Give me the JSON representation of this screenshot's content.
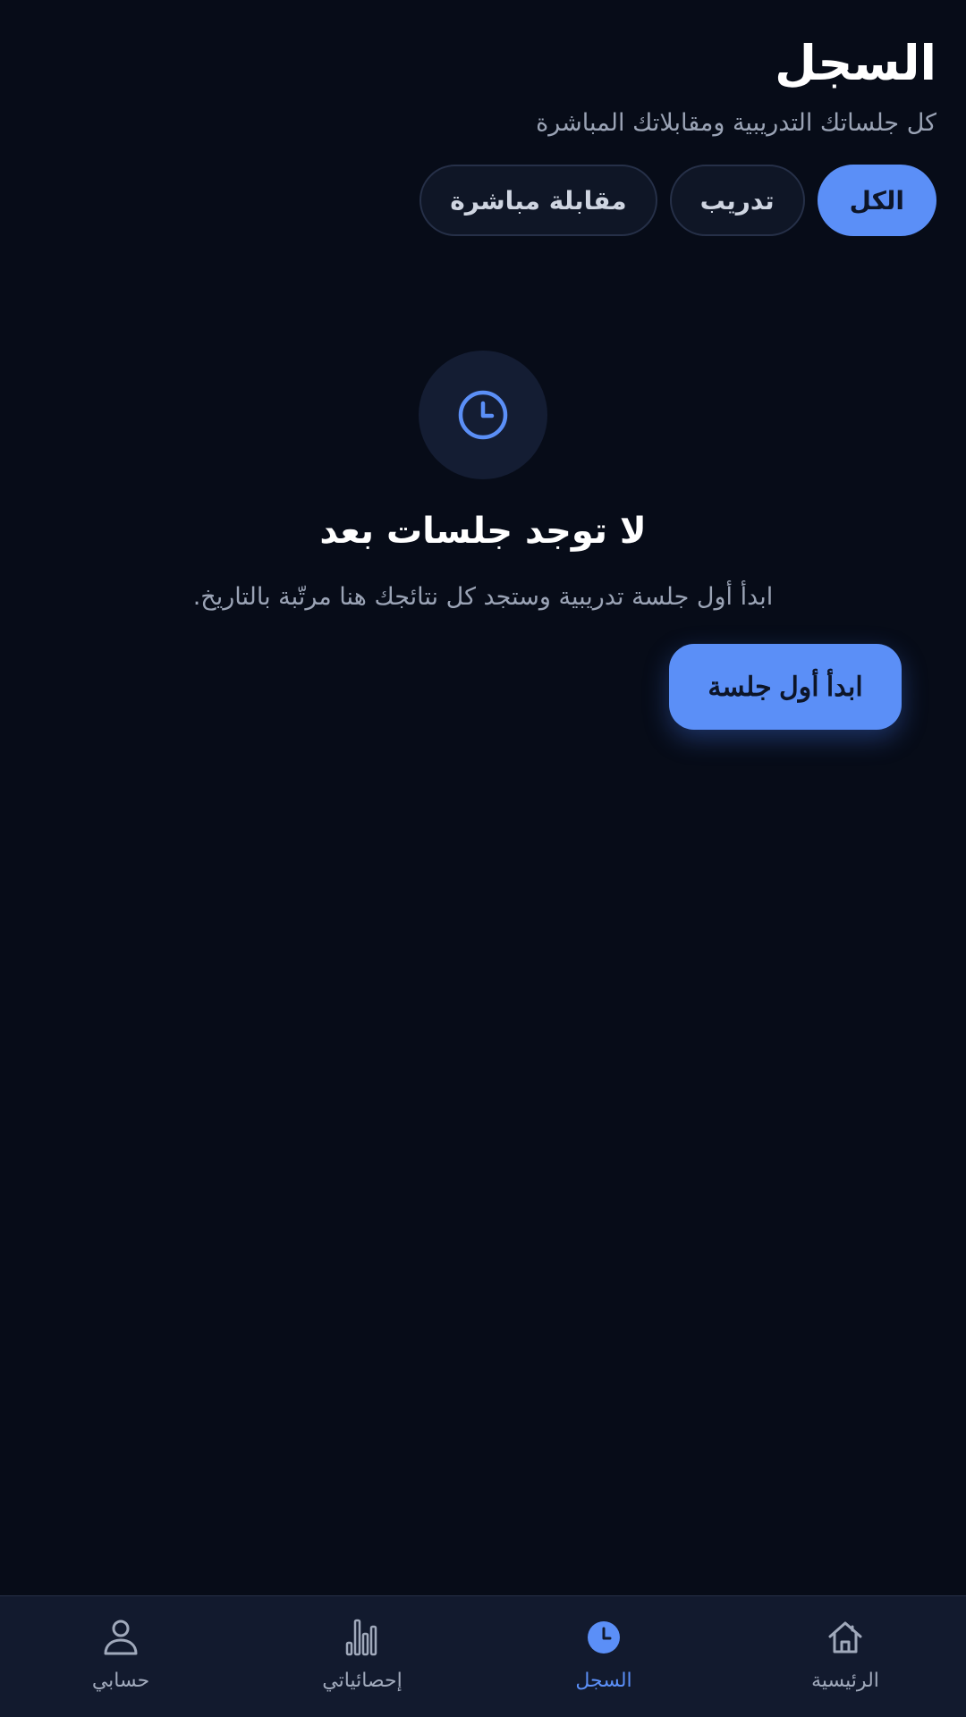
{
  "header": {
    "title": "السجل",
    "subtitle": "كل جلساتك التدريبية ومقابلاتك المباشرة"
  },
  "filters": [
    {
      "label": "الكل",
      "active": true
    },
    {
      "label": "تدريب",
      "active": false
    },
    {
      "label": "مقابلة مباشرة",
      "active": false
    }
  ],
  "empty_state": {
    "icon": "clock-icon",
    "title": "لا توجد جلسات بعد",
    "description": "ابدأ أول جلسة تدريبية وستجد كل نتائجك هنا مرتّبة بالتاريخ.",
    "cta_label": "ابدأ أول جلسة"
  },
  "bottom_nav": [
    {
      "label": "الرئيسية",
      "icon": "home-icon",
      "active": false
    },
    {
      "label": "السجل",
      "icon": "clock-icon",
      "active": true
    },
    {
      "label": "إحصائياتي",
      "icon": "bar-chart-icon",
      "active": false
    },
    {
      "label": "حسابي",
      "icon": "user-icon",
      "active": false
    }
  ],
  "colors": {
    "background": "#070c18",
    "accent": "#5b8ff7",
    "nav_background": "#121a2e",
    "muted_text": "#9aa3b5"
  }
}
